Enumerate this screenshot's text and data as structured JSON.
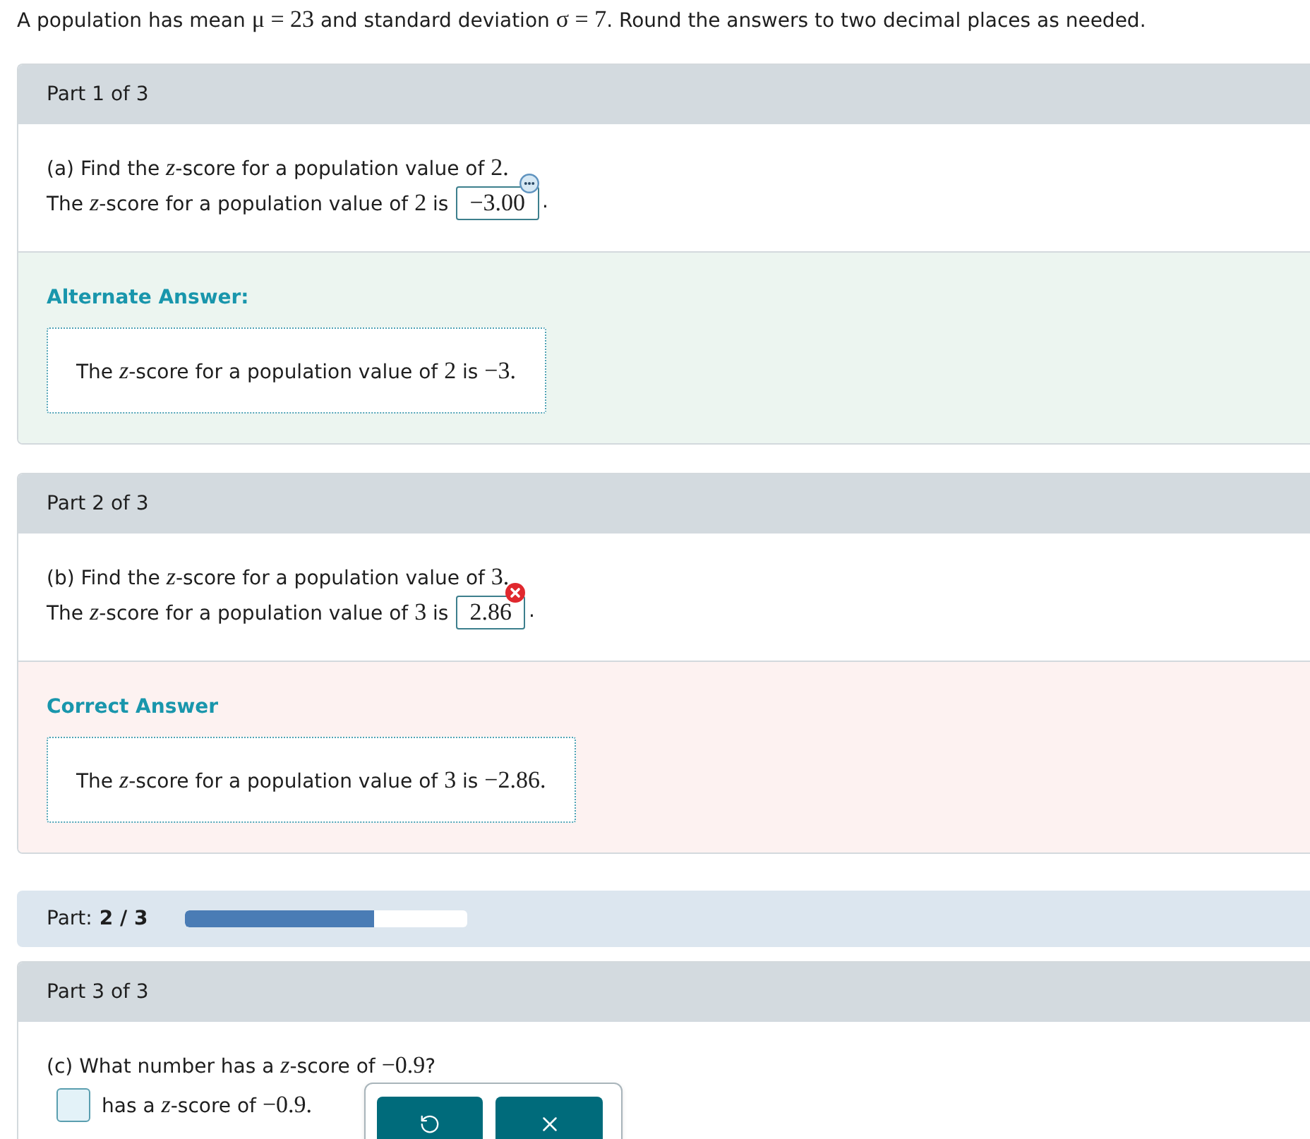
{
  "problem": [
    {
      "kind": "text",
      "text": "A population has mean "
    },
    {
      "kind": "num",
      "text": "μ = 23"
    },
    {
      "kind": "text",
      "text": " and standard deviation "
    },
    {
      "kind": "num",
      "text": "σ = 7"
    },
    {
      "kind": "text",
      "text": ". Round the answers to two decimal places as needed."
    }
  ],
  "sections": [
    {
      "kind": "part",
      "header": "Part 1 of 3",
      "tool_panel_open": false,
      "question": [
        {
          "kind": "text",
          "text": "(a) Find the "
        },
        {
          "kind": "var",
          "text": "z"
        },
        {
          "kind": "text",
          "text": "-score for a population value of "
        },
        {
          "kind": "num",
          "text": "2."
        }
      ],
      "answer": [
        {
          "kind": "text",
          "text": "The "
        },
        {
          "kind": "var",
          "text": "z"
        },
        {
          "kind": "text",
          "text": "-score for a population value of "
        },
        {
          "kind": "num",
          "text": "2"
        },
        {
          "kind": "text",
          "text": " is"
        },
        {
          "kind": "input",
          "value": "−3.00",
          "correct": true
        },
        {
          "kind": "text",
          "text": "."
        }
      ],
      "feedback": {
        "kind": "alternate",
        "heading": "Alternate Answer:",
        "answer": [
          {
            "kind": "text",
            "text": "The "
          },
          {
            "kind": "var",
            "text": "z"
          },
          {
            "kind": "text",
            "text": "-score for a population value of "
          },
          {
            "kind": "num",
            "text": "2"
          },
          {
            "kind": "text",
            "text": " is "
          },
          {
            "kind": "num",
            "text": "−3."
          }
        ]
      }
    },
    {
      "kind": "part",
      "header": "Part 2 of 3",
      "tool_panel_open": false,
      "question": [
        {
          "kind": "text",
          "text": "(b) Find the "
        },
        {
          "kind": "var",
          "text": "z"
        },
        {
          "kind": "text",
          "text": "-score for a population value of "
        },
        {
          "kind": "num",
          "text": "3."
        }
      ],
      "answer": [
        {
          "kind": "text",
          "text": "The "
        },
        {
          "kind": "var",
          "text": "z"
        },
        {
          "kind": "text",
          "text": "-score for a population value of "
        },
        {
          "kind": "num",
          "text": "3"
        },
        {
          "kind": "text",
          "text": " is"
        },
        {
          "kind": "input",
          "value": "2.86",
          "correct": false
        },
        {
          "kind": "text",
          "text": "."
        }
      ],
      "feedback": {
        "kind": "incorrect",
        "heading": "Correct Answer",
        "answer": [
          {
            "kind": "text",
            "text": "The "
          },
          {
            "kind": "var",
            "text": "z"
          },
          {
            "kind": "text",
            "text": "-score for a population value of "
          },
          {
            "kind": "num",
            "text": "3"
          },
          {
            "kind": "text",
            "text": " is "
          },
          {
            "kind": "num",
            "text": "−2.86."
          }
        ]
      }
    },
    {
      "kind": "progress",
      "label": "Part:",
      "value": "2 / 3",
      "level": 0.67
    },
    {
      "kind": "part",
      "header": "Part 3 of 3",
      "tool_panel_open": true,
      "question": [
        {
          "kind": "text",
          "text": "(c) What number has a "
        },
        {
          "kind": "var",
          "text": "z"
        },
        {
          "kind": "text",
          "text": "-score of "
        },
        {
          "kind": "num",
          "text": "−0.9"
        },
        {
          "kind": "text",
          "text": "?"
        }
      ],
      "answer": [
        {
          "kind": "input"
        },
        {
          "kind": "text",
          "text": "has a "
        },
        {
          "kind": "var",
          "text": "z"
        },
        {
          "kind": "text",
          "text": "-score of "
        },
        {
          "kind": "num",
          "text": "−0.9."
        }
      ]
    }
  ]
}
